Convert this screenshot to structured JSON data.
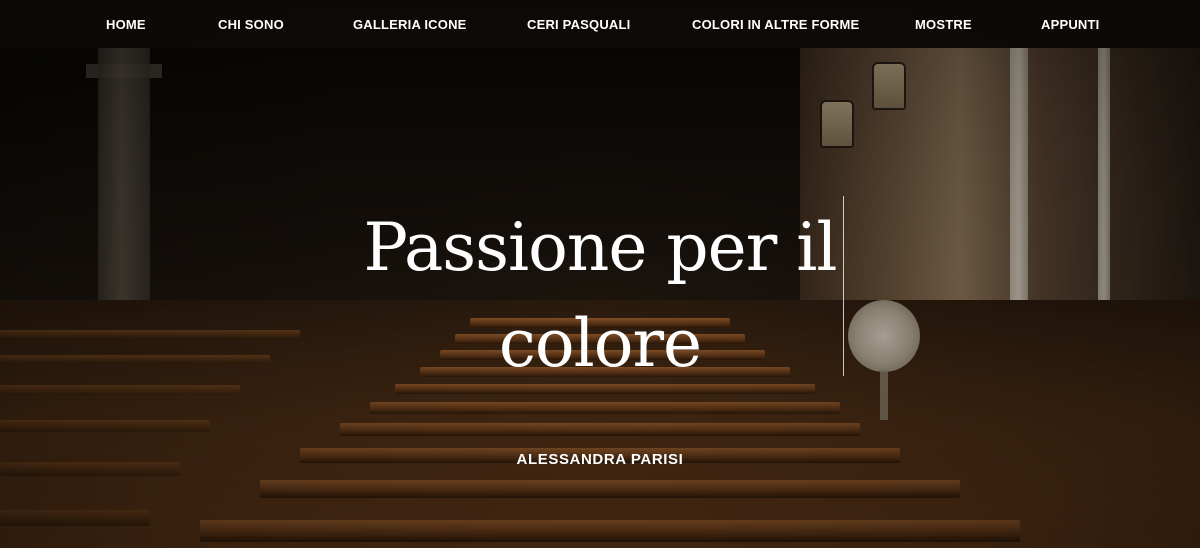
{
  "nav": {
    "items": [
      {
        "label": "HOME"
      },
      {
        "label": "CHI SONO"
      },
      {
        "label": "GALLERIA ICONE"
      },
      {
        "label": "CERI PASQUALI"
      },
      {
        "label": "COLORI IN ALTRE FORME"
      },
      {
        "label": "MOSTRE"
      },
      {
        "label": "APPUNTI"
      }
    ]
  },
  "hero": {
    "title": "Passione per il colore",
    "subtitle": "ALESSANDRA PARISI",
    "background_image": "church-pews-photo"
  },
  "colors": {
    "text": "#ffffff",
    "nav_background": "#100c09",
    "wood": "#5a3417"
  }
}
